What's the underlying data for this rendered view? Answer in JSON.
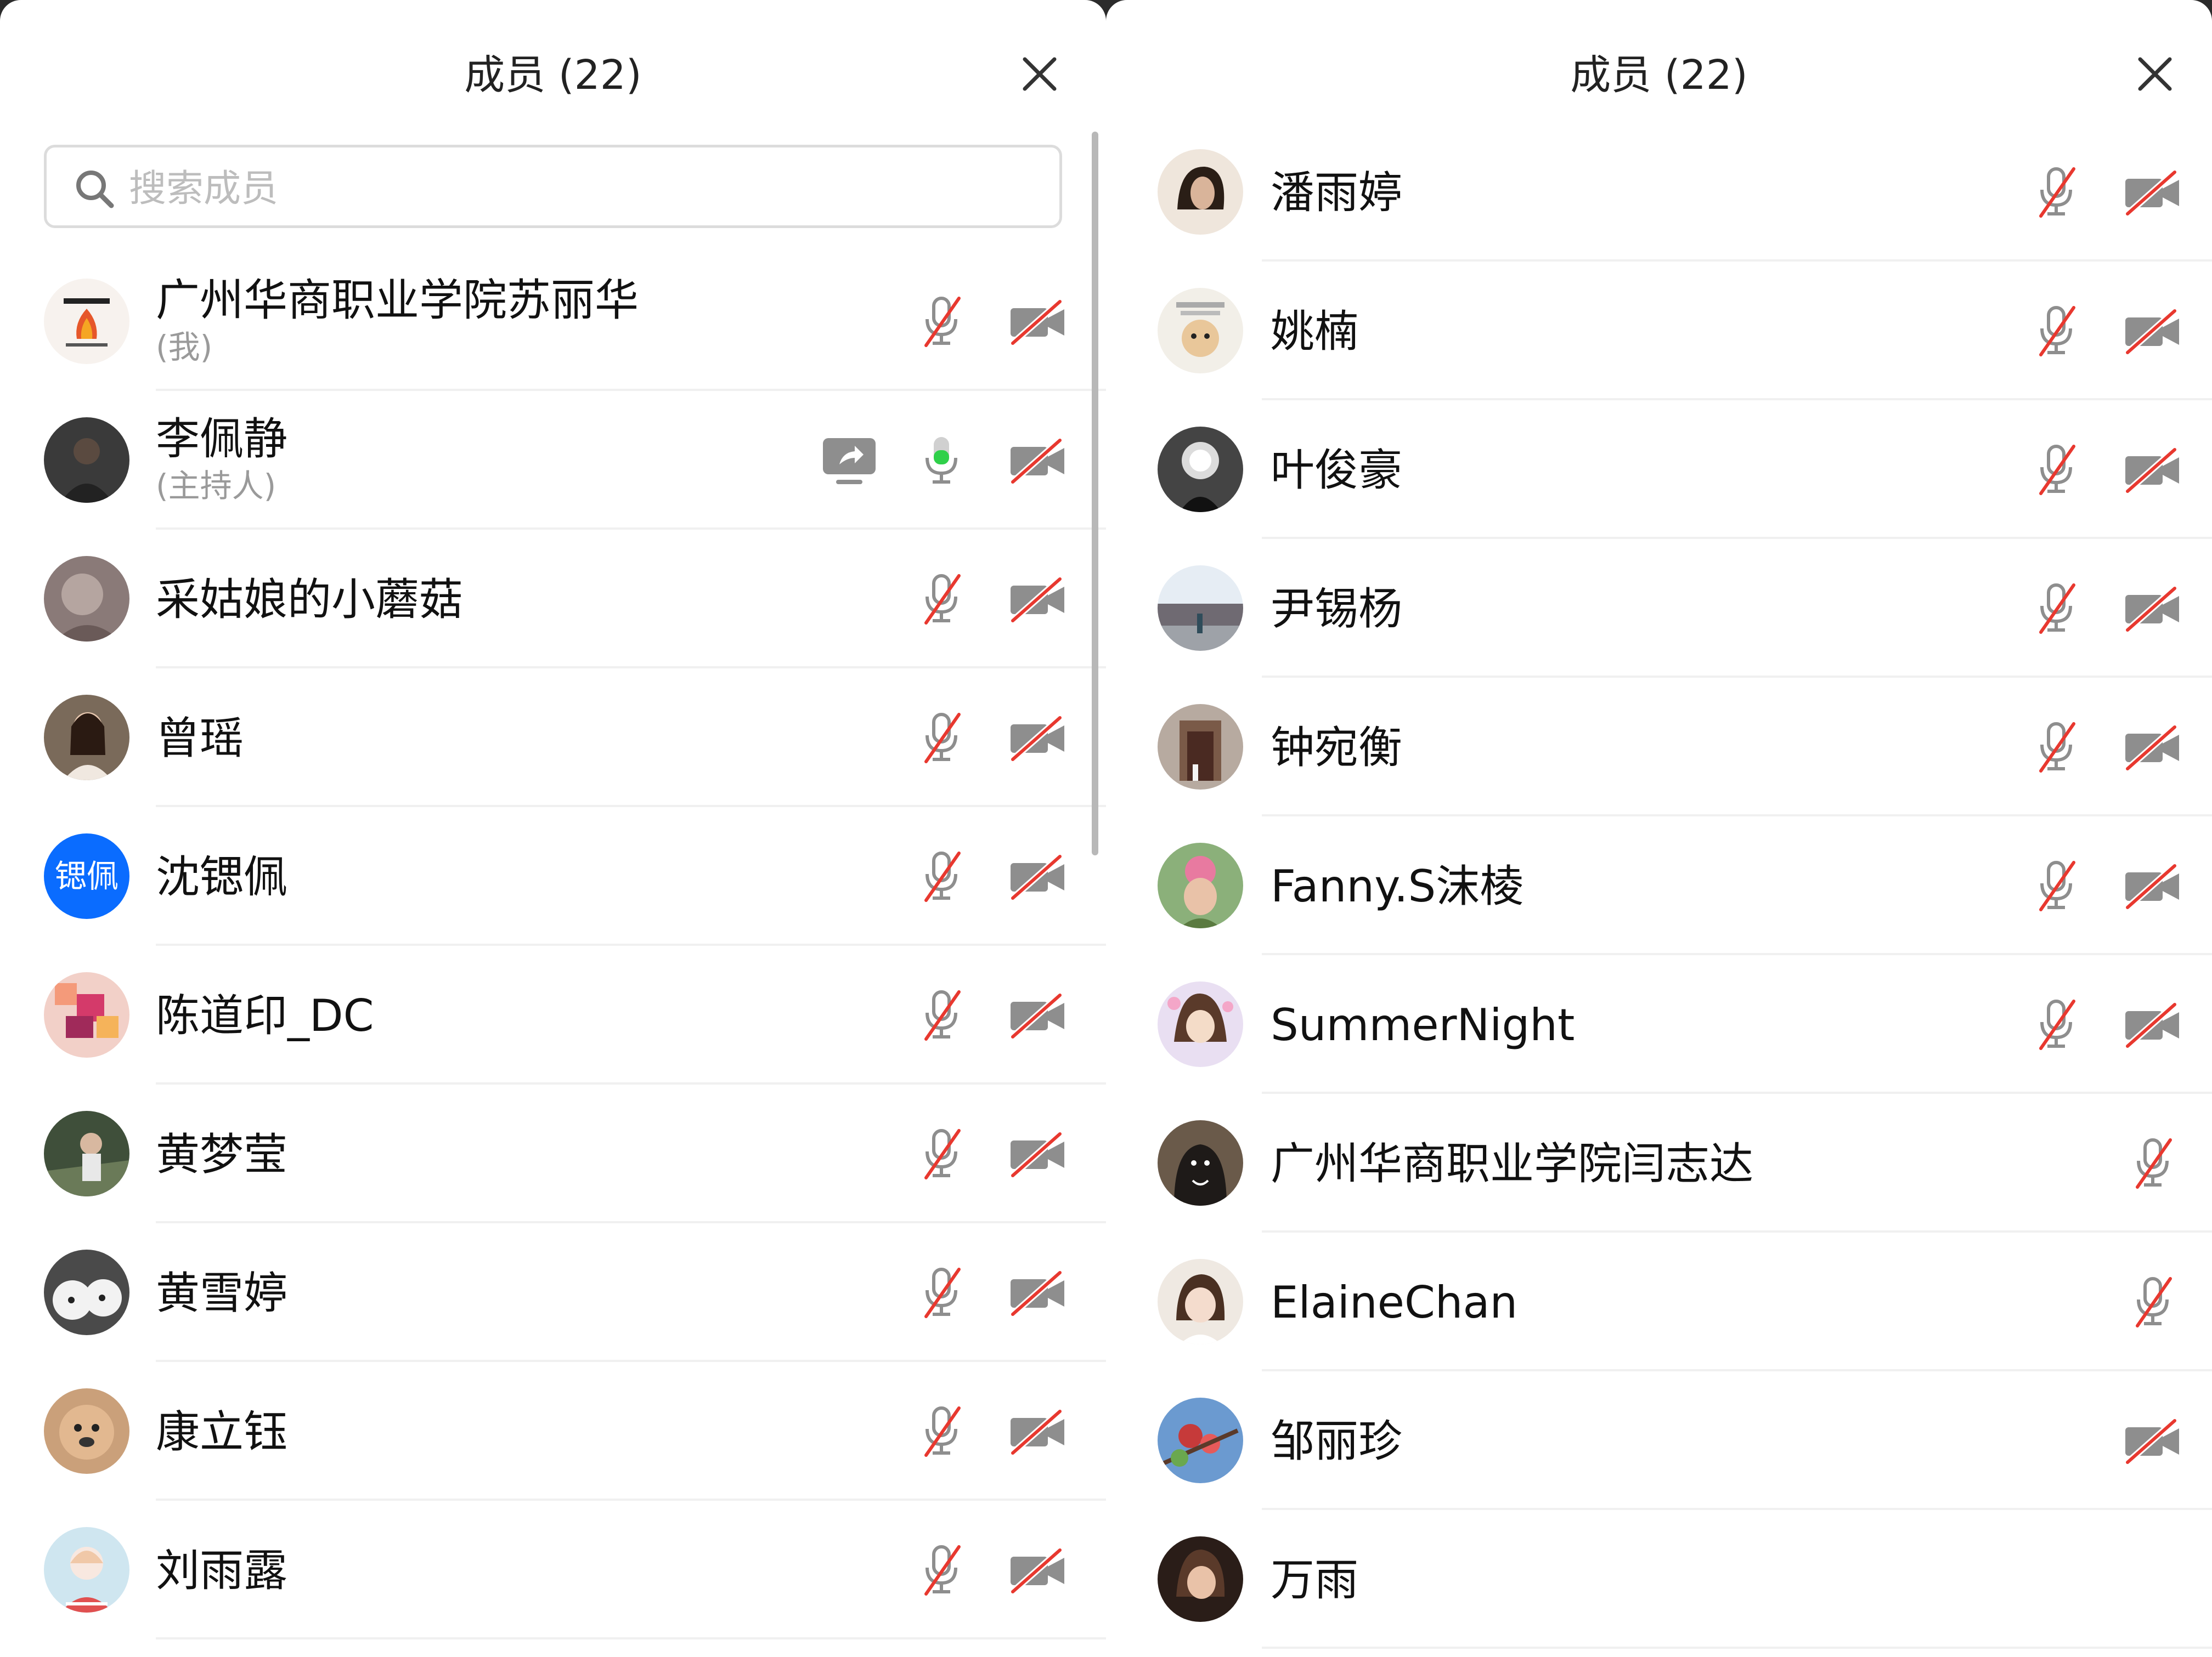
{
  "left_panel": {
    "title": "成员 (22)",
    "search_placeholder": "搜索成员",
    "members": [
      {
        "name": "广州华商职业学院苏丽华",
        "sub": "(我)"
      },
      {
        "name": "李佩静",
        "sub": "(主持人)"
      },
      {
        "name": "采姑娘的小蘑菇"
      },
      {
        "name": "曾瑶"
      },
      {
        "name": "沈锶佩",
        "avatar_text": "锶佩"
      },
      {
        "name": "陈道印_DC"
      },
      {
        "name": "黄梦莹"
      },
      {
        "name": "黄雪婷"
      },
      {
        "name": "康立钰"
      },
      {
        "name": "刘雨露"
      }
    ]
  },
  "right_panel": {
    "title": "成员 (22)",
    "members": [
      {
        "name": "潘雨婷"
      },
      {
        "name": "姚楠"
      },
      {
        "name": "叶俊豪"
      },
      {
        "name": "尹锡杨"
      },
      {
        "name": "钟宛衡"
      },
      {
        "name": "Fanny.S沫棱"
      },
      {
        "name": "SummerNight"
      },
      {
        "name": "广州华商职业学院闫志达"
      },
      {
        "name": "ElaineChan"
      },
      {
        "name": "邹丽珍"
      },
      {
        "name": "万雨"
      }
    ]
  },
  "icons": {
    "close": "close-icon",
    "search": "search-icon",
    "mic_muted": "mic-muted-icon",
    "mic_active": "mic-active-icon",
    "camera_off": "camera-off-icon",
    "screen_share": "screen-share-icon"
  },
  "colors": {
    "accent_blue": "#0a6cff",
    "mute_red": "#e8382f",
    "icon_gray": "#8e8e8e",
    "speaking_green": "#2fd04a"
  }
}
